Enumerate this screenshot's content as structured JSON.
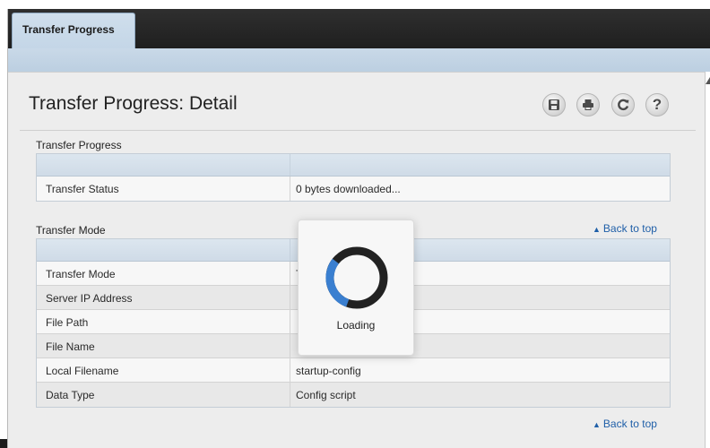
{
  "tabs": [
    {
      "label": "Transfer Progress",
      "active": true
    }
  ],
  "page": {
    "title": "Transfer Progress: Detail"
  },
  "toolbar": {
    "save_icon": "save-icon",
    "print_icon": "print-icon",
    "refresh_icon": "refresh-icon",
    "help_icon": "help-icon",
    "help_glyph": "?"
  },
  "sections": {
    "progress": {
      "title": "Transfer Progress",
      "rows": [
        {
          "label": "Transfer Status",
          "value": "0 bytes downloaded..."
        }
      ]
    },
    "mode": {
      "title": "Transfer Mode",
      "back_to_top": "Back to top",
      "rows": [
        {
          "label": "Transfer Mode",
          "value": "T"
        },
        {
          "label": "Server IP Address",
          "value": ""
        },
        {
          "label": "File Path",
          "value": ""
        },
        {
          "label": "File Name",
          "value": ""
        },
        {
          "label": "Local Filename",
          "value": "startup-config"
        },
        {
          "label": "Data Type",
          "value": "Config script"
        }
      ]
    },
    "bottom_back_to_top": "Back to top"
  },
  "loading": {
    "label": "Loading",
    "progress": 0.3
  },
  "colors": {
    "tab_bar": "#2a2a2a",
    "tab_active": "#c9d9e9",
    "link": "#1f5fa8",
    "spinner_track": "#222222",
    "spinner_fill": "#3a7fd0"
  }
}
